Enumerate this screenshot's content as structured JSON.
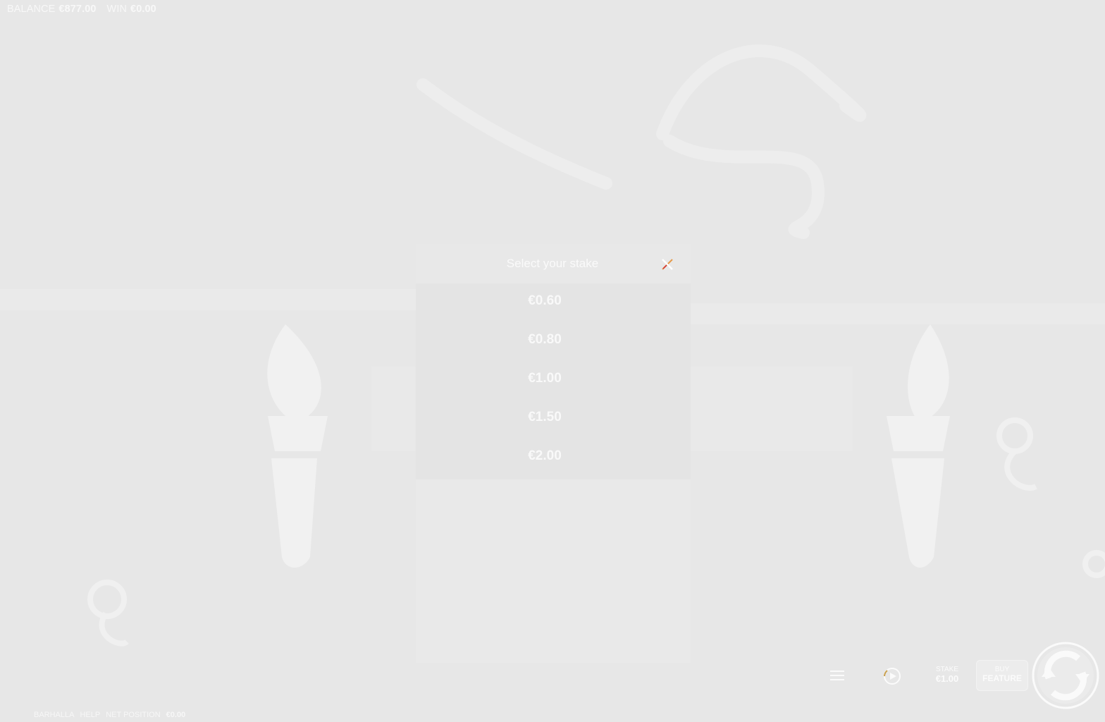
{
  "top_bar": {
    "balance_label": "BALANCE",
    "balance_value": "€877.00",
    "win_label": "WIN",
    "win_value": "€0.00"
  },
  "stake_dialog": {
    "title": "Select your stake",
    "options": [
      "€0.60",
      "€0.80",
      "€1.00",
      "€1.50",
      "€2.00"
    ]
  },
  "controls": {
    "stake_label": "STAKE",
    "stake_value": "€1.00",
    "buy_label_top": "BUY",
    "buy_label_bottom": "FEATURE"
  },
  "footer": {
    "game_name": "BARHALLA",
    "help": "HELP",
    "net_position_label": "NET POSITION",
    "net_position_value": "€0.00"
  }
}
